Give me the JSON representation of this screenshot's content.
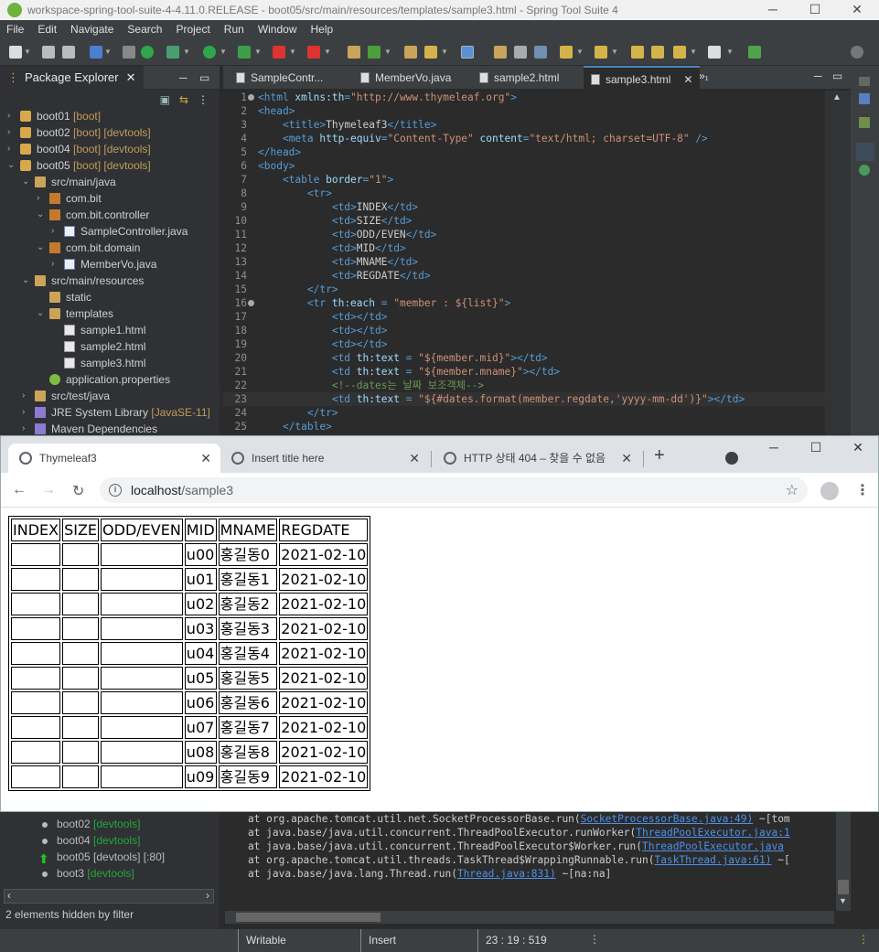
{
  "ide": {
    "window_title": "workspace-spring-tool-suite-4-4.11.0.RELEASE - boot05/src/main/resources/templates/sample3.html - Spring Tool Suite 4",
    "menu": [
      "File",
      "Edit",
      "Navigate",
      "Search",
      "Project",
      "Run",
      "Window",
      "Help"
    ],
    "package_explorer": {
      "title": "Package Explorer",
      "close": "✕",
      "tree": [
        {
          "text": "boot01",
          "deco": "[boot]",
          "indent": 0,
          "twisty": "›",
          "icon": "project"
        },
        {
          "text": "boot02",
          "deco": "[boot] [devtools]",
          "indent": 0,
          "twisty": "›",
          "icon": "project"
        },
        {
          "text": "boot04",
          "deco": "[boot] [devtools]",
          "indent": 0,
          "twisty": "›",
          "icon": "project"
        },
        {
          "text": "boot05",
          "deco": "[boot] [devtools]",
          "indent": 0,
          "twisty": "⌄",
          "icon": "project"
        },
        {
          "text": "src/main/java",
          "deco": "",
          "indent": 1,
          "twisty": "⌄",
          "icon": "source-folder"
        },
        {
          "text": "com.bit",
          "deco": "",
          "indent": 2,
          "twisty": "›",
          "icon": "package"
        },
        {
          "text": "com.bit.controller",
          "deco": "",
          "indent": 2,
          "twisty": "⌄",
          "icon": "package"
        },
        {
          "text": "SampleController.java",
          "deco": "",
          "indent": 3,
          "twisty": "›",
          "icon": "java-file"
        },
        {
          "text": "com.bit.domain",
          "deco": "",
          "indent": 2,
          "twisty": "⌄",
          "icon": "package"
        },
        {
          "text": "MemberVo.java",
          "deco": "",
          "indent": 3,
          "twisty": "›",
          "icon": "java-file"
        },
        {
          "text": "src/main/resources",
          "deco": "",
          "indent": 1,
          "twisty": "⌄",
          "icon": "source-folder"
        },
        {
          "text": "static",
          "deco": "",
          "indent": 2,
          "twisty": "",
          "icon": "folder"
        },
        {
          "text": "templates",
          "deco": "",
          "indent": 2,
          "twisty": "⌄",
          "icon": "folder"
        },
        {
          "text": "sample1.html",
          "deco": "",
          "indent": 3,
          "twisty": "",
          "icon": "html-file"
        },
        {
          "text": "sample2.html",
          "deco": "",
          "indent": 3,
          "twisty": "",
          "icon": "html-file"
        },
        {
          "text": "sample3.html",
          "deco": "",
          "indent": 3,
          "twisty": "",
          "icon": "html-file"
        },
        {
          "text": "application.properties",
          "deco": "",
          "indent": 2,
          "twisty": "",
          "icon": "properties"
        },
        {
          "text": "src/test/java",
          "deco": "",
          "indent": 1,
          "twisty": "›",
          "icon": "source-folder"
        },
        {
          "text": "JRE System Library",
          "deco": "[JavaSE-11]",
          "indent": 1,
          "twisty": "›",
          "icon": "library"
        },
        {
          "text": "Maven Dependencies",
          "deco": "",
          "indent": 1,
          "twisty": "›",
          "icon": "library"
        }
      ]
    },
    "editor_tabs": [
      {
        "label": "SampleContr...",
        "active": false
      },
      {
        "label": "MemberVo.java",
        "active": false
      },
      {
        "label": "sample2.html",
        "active": false
      },
      {
        "label": "sample3.html",
        "active": true,
        "close": "✕"
      }
    ],
    "tabs_overflow": "»₁",
    "code_lines": [
      {
        "n": "1",
        "fold": true,
        "parts": [
          [
            "t",
            "<html "
          ],
          [
            "a",
            "xmlns:th"
          ],
          [
            "t",
            "="
          ],
          [
            "s",
            "\"http://www.thymeleaf.org\""
          ],
          [
            "t",
            ">"
          ]
        ]
      },
      {
        "n": "2",
        "parts": [
          [
            "t",
            "<head>"
          ]
        ]
      },
      {
        "n": "3",
        "parts": [
          [
            "x",
            "    "
          ],
          [
            "t",
            "<title>"
          ],
          [
            "x",
            "Thymeleaf3"
          ],
          [
            "t",
            "</title>"
          ]
        ]
      },
      {
        "n": "4",
        "parts": [
          [
            "x",
            "    "
          ],
          [
            "t",
            "<meta "
          ],
          [
            "a",
            "http-equiv"
          ],
          [
            "t",
            "="
          ],
          [
            "s",
            "\"Content-Type\""
          ],
          [
            "x",
            " "
          ],
          [
            "a",
            "content"
          ],
          [
            "t",
            "="
          ],
          [
            "s",
            "\"text/html; charset=UTF-8\""
          ],
          [
            "x",
            " "
          ],
          [
            "t",
            "/>"
          ]
        ]
      },
      {
        "n": "5",
        "parts": [
          [
            "t",
            "</head>"
          ]
        ]
      },
      {
        "n": "6",
        "parts": [
          [
            "t",
            "<body>"
          ]
        ]
      },
      {
        "n": "7",
        "parts": [
          [
            "x",
            "    "
          ],
          [
            "t",
            "<table "
          ],
          [
            "a",
            "border"
          ],
          [
            "t",
            "="
          ],
          [
            "s",
            "\"1\""
          ],
          [
            "t",
            ">"
          ]
        ]
      },
      {
        "n": "8",
        "parts": [
          [
            "x",
            "        "
          ],
          [
            "t",
            "<tr>"
          ]
        ]
      },
      {
        "n": "9",
        "parts": [
          [
            "x",
            "            "
          ],
          [
            "t",
            "<td>"
          ],
          [
            "x",
            "INDEX"
          ],
          [
            "t",
            "</td>"
          ]
        ]
      },
      {
        "n": "10",
        "parts": [
          [
            "x",
            "            "
          ],
          [
            "t",
            "<td>"
          ],
          [
            "x",
            "SIZE"
          ],
          [
            "t",
            "</td>"
          ]
        ]
      },
      {
        "n": "11",
        "parts": [
          [
            "x",
            "            "
          ],
          [
            "t",
            "<td>"
          ],
          [
            "x",
            "ODD/EVEN"
          ],
          [
            "t",
            "</td>"
          ]
        ]
      },
      {
        "n": "12",
        "parts": [
          [
            "x",
            "            "
          ],
          [
            "t",
            "<td>"
          ],
          [
            "x",
            "MID"
          ],
          [
            "t",
            "</td>"
          ]
        ]
      },
      {
        "n": "13",
        "parts": [
          [
            "x",
            "            "
          ],
          [
            "t",
            "<td>"
          ],
          [
            "x",
            "MNAME"
          ],
          [
            "t",
            "</td>"
          ]
        ]
      },
      {
        "n": "14",
        "parts": [
          [
            "x",
            "            "
          ],
          [
            "t",
            "<td>"
          ],
          [
            "x",
            "REGDATE"
          ],
          [
            "t",
            "</td>"
          ]
        ]
      },
      {
        "n": "15",
        "parts": [
          [
            "x",
            "        "
          ],
          [
            "t",
            "</tr>"
          ]
        ]
      },
      {
        "n": "16",
        "fold": true,
        "parts": [
          [
            "x",
            "        "
          ],
          [
            "t",
            "<tr "
          ],
          [
            "a",
            "th:each"
          ],
          [
            "x",
            " "
          ],
          [
            "t",
            "="
          ],
          [
            "x",
            " "
          ],
          [
            "s",
            "\"member : ${list}\""
          ],
          [
            "t",
            ">"
          ]
        ]
      },
      {
        "n": "17",
        "parts": [
          [
            "x",
            "            "
          ],
          [
            "t",
            "<td></td>"
          ]
        ]
      },
      {
        "n": "18",
        "parts": [
          [
            "x",
            "            "
          ],
          [
            "t",
            "<td></td>"
          ]
        ]
      },
      {
        "n": "19",
        "parts": [
          [
            "x",
            "            "
          ],
          [
            "t",
            "<td></td>"
          ]
        ]
      },
      {
        "n": "20",
        "parts": [
          [
            "x",
            "            "
          ],
          [
            "t",
            "<td "
          ],
          [
            "a",
            "th:text"
          ],
          [
            "x",
            " "
          ],
          [
            "t",
            "="
          ],
          [
            "x",
            " "
          ],
          [
            "s",
            "\"${member.mid}\""
          ],
          [
            "t",
            "></td>"
          ]
        ]
      },
      {
        "n": "21",
        "parts": [
          [
            "x",
            "            "
          ],
          [
            "t",
            "<td "
          ],
          [
            "a",
            "th:text"
          ],
          [
            "x",
            " "
          ],
          [
            "t",
            "="
          ],
          [
            "x",
            " "
          ],
          [
            "s",
            "\"${member.mname}\""
          ],
          [
            "t",
            "></td>"
          ]
        ]
      },
      {
        "n": "22",
        "parts": [
          [
            "x",
            "            "
          ],
          [
            "c",
            "<!--dates는 날짜 보조객체-->"
          ]
        ]
      },
      {
        "n": "23",
        "cur": true,
        "parts": [
          [
            "x",
            "            "
          ],
          [
            "t",
            "<td "
          ],
          [
            "a",
            "th:text"
          ],
          [
            "x",
            " "
          ],
          [
            "t",
            "="
          ],
          [
            "x",
            " "
          ],
          [
            "s",
            "\"${#dates.format(member.regdate,'yyyy-mm-dd')}\""
          ],
          [
            "t",
            "></td>"
          ]
        ]
      },
      {
        "n": "24",
        "parts": [
          [
            "x",
            "        "
          ],
          [
            "t",
            "</tr>"
          ]
        ]
      },
      {
        "n": "25",
        "parts": [
          [
            "x",
            "    "
          ],
          [
            "t",
            "</table>"
          ]
        ]
      }
    ],
    "servers": [
      {
        "name": "boot02",
        "deco": "[devtools]",
        "state": "stopped"
      },
      {
        "name": "boot04",
        "deco": "[devtools]",
        "state": "stopped"
      },
      {
        "name": "boot05",
        "deco": "[devtools] [:80]",
        "state": "running"
      },
      {
        "name": "boot3",
        "deco": "[devtools]",
        "state": "stopped"
      }
    ],
    "hidden_note": "2 elements hidden by filter",
    "console_lines": [
      {
        "pre": "    at org.apache.tomcat.util.net.SocketProcessorBase.run(",
        "link": "SocketProcessorBase.java:49)",
        "post": " ~[tom"
      },
      {
        "pre": "    at java.base/java.util.concurrent.ThreadPoolExecutor.runWorker(",
        "link": "ThreadPoolExecutor.java:1",
        "post": ""
      },
      {
        "pre": "    at java.base/java.util.concurrent.ThreadPoolExecutor$Worker.run(",
        "link": "ThreadPoolExecutor.java",
        "post": ""
      },
      {
        "pre": "    at org.apache.tomcat.util.threads.TaskThread$WrappingRunnable.run(",
        "link": "TaskThread.java:61)",
        "post": " ~["
      },
      {
        "pre": "    at java.base/java.lang.Thread.run(",
        "link": "Thread.java:831)",
        "post": " ~[na:na]"
      }
    ],
    "status": {
      "writable": "Writable",
      "insert": "Insert",
      "position": "23 : 19 : 519"
    }
  },
  "browser": {
    "tabs": [
      {
        "title": "Thymeleaf3",
        "active": true
      },
      {
        "title": "Insert title here",
        "active": false
      },
      {
        "title": "HTTP 상태 404 – 찾을 수 없음",
        "active": false
      }
    ],
    "tab_close": "✕",
    "new_tab": "+",
    "address": {
      "host": "localhost",
      "path": "/sample3"
    },
    "table": {
      "headers": [
        "INDEX",
        "SIZE",
        "ODD/EVEN",
        "MID",
        "MNAME",
        "REGDATE"
      ],
      "rows": [
        [
          "",
          "",
          "",
          "u00",
          "홍길동0",
          "2021-02-10"
        ],
        [
          "",
          "",
          "",
          "u01",
          "홍길동1",
          "2021-02-10"
        ],
        [
          "",
          "",
          "",
          "u02",
          "홍길동2",
          "2021-02-10"
        ],
        [
          "",
          "",
          "",
          "u03",
          "홍길동3",
          "2021-02-10"
        ],
        [
          "",
          "",
          "",
          "u04",
          "홍길동4",
          "2021-02-10"
        ],
        [
          "",
          "",
          "",
          "u05",
          "홍길동5",
          "2021-02-10"
        ],
        [
          "",
          "",
          "",
          "u06",
          "홍길동6",
          "2021-02-10"
        ],
        [
          "",
          "",
          "",
          "u07",
          "홍길동7",
          "2021-02-10"
        ],
        [
          "",
          "",
          "",
          "u08",
          "홍길동8",
          "2021-02-10"
        ],
        [
          "",
          "",
          "",
          "u09",
          "홍길동9",
          "2021-02-10"
        ]
      ]
    }
  }
}
